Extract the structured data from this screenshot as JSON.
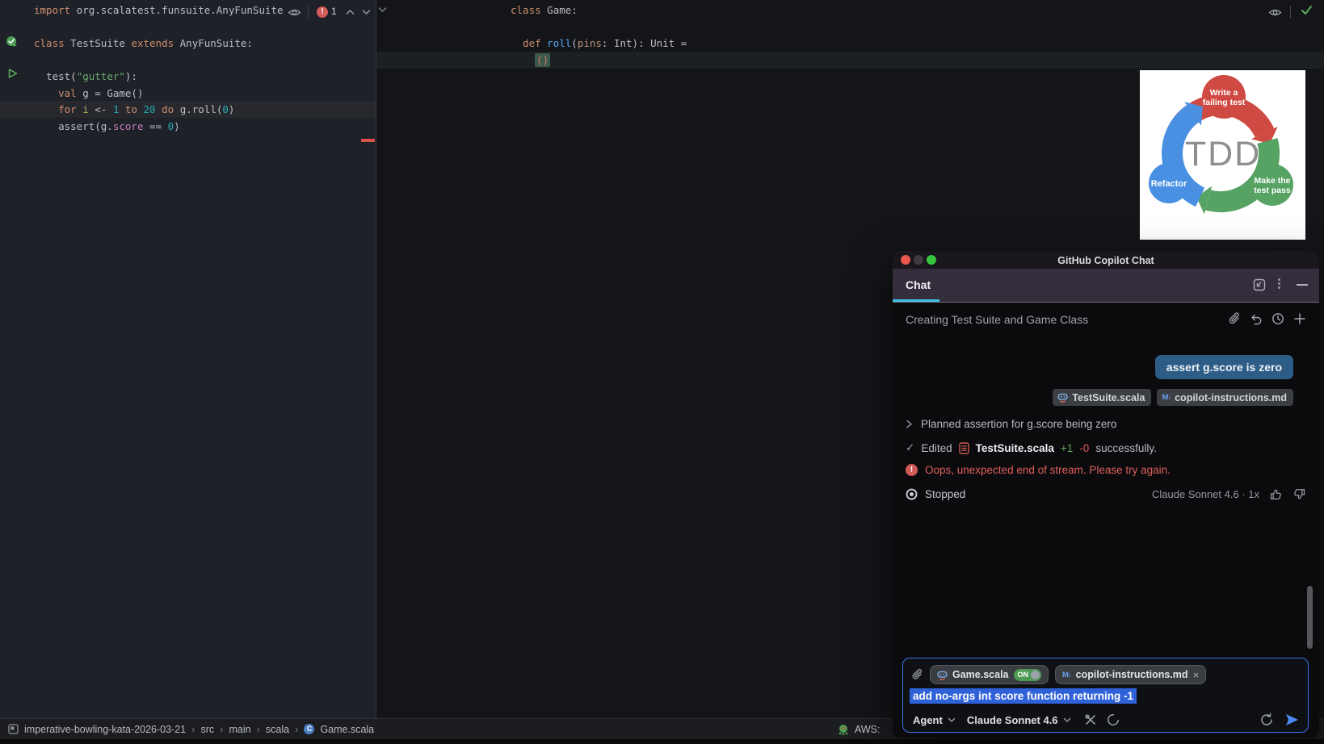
{
  "left_editor": {
    "error_count": "1",
    "lines": [
      {
        "tokens": [
          [
            "import",
            "kw"
          ],
          [
            " org.scalatest.funsuite.AnyFunSuite",
            "pl"
          ]
        ]
      },
      {
        "tokens": []
      },
      {
        "tokens": [
          [
            "class",
            "kw"
          ],
          [
            " TestSuite ",
            "pl"
          ],
          [
            "extends",
            "kw"
          ],
          [
            " AnyFunSuite:",
            "pl"
          ]
        ]
      },
      {
        "tokens": []
      },
      {
        "tokens": [
          [
            "  test(",
            "pl"
          ],
          [
            "\"gutter\"",
            "str"
          ],
          [
            "):",
            "pl"
          ]
        ]
      },
      {
        "tokens": [
          [
            "    ",
            "pl"
          ],
          [
            "val",
            "kw"
          ],
          [
            " g = Game()",
            "pl"
          ]
        ]
      },
      {
        "tokens": [
          [
            "    ",
            "pl"
          ],
          [
            "for",
            "kw"
          ],
          [
            " ",
            "pl"
          ],
          [
            "i",
            "var"
          ],
          [
            " <- ",
            "pl"
          ],
          [
            "1",
            "num"
          ],
          [
            " ",
            "pl"
          ],
          [
            "to",
            "kw"
          ],
          [
            " ",
            "pl"
          ],
          [
            "20",
            "num"
          ],
          [
            " ",
            "pl"
          ],
          [
            "do",
            "kw"
          ],
          [
            " g.roll(",
            "pl"
          ],
          [
            "0",
            "num"
          ],
          [
            ")",
            "pl"
          ]
        ],
        "current": true
      },
      {
        "tokens": [
          [
            "    assert(g.",
            "pl"
          ],
          [
            "score",
            "member"
          ],
          [
            " == ",
            "pl"
          ],
          [
            "0",
            "num"
          ],
          [
            ")",
            "pl"
          ]
        ]
      }
    ]
  },
  "right_editor": {
    "lines": [
      {
        "tokens": [
          [
            "class",
            "kw"
          ],
          [
            " Game:",
            "pl"
          ]
        ]
      },
      {
        "tokens": []
      },
      {
        "tokens": [
          [
            "  ",
            "pl"
          ],
          [
            "def",
            "kw"
          ],
          [
            " ",
            "pl"
          ],
          [
            "roll",
            "fn"
          ],
          [
            "(",
            "pl"
          ],
          [
            "pins",
            "param"
          ],
          [
            ": Int): Unit =",
            "pl"
          ]
        ]
      },
      {
        "tokens": [
          [
            "    ",
            "pl"
          ],
          [
            "()",
            "sel"
          ]
        ],
        "current": true
      }
    ]
  },
  "tdd": {
    "center": "TDD",
    "red_label": [
      "Write a",
      "failing test"
    ],
    "green_label": [
      "Make the",
      "test pass"
    ],
    "blue_label": "Refactor",
    "colors": {
      "red": "#cf4a42",
      "green": "#57a364",
      "blue": "#4a90e2",
      "center_gray": "#8f8f8f"
    }
  },
  "chat": {
    "window_title": "GitHub Copilot Chat",
    "tab_label": "Chat",
    "thread_title": "Creating Test Suite and Game Class",
    "user_message": "assert g.score is zero",
    "attachments": {
      "0": {
        "label": "TestSuite.scala"
      },
      "1": {
        "label": "copilot-instructions.md"
      }
    },
    "planned_step": "Planned assertion for g.score being zero",
    "edited": {
      "verb": "Edited",
      "check": "✓",
      "file": "TestSuite.scala",
      "added": "+1",
      "removed": "-0",
      "suffix": "successfully."
    },
    "error_message": "Oops, unexpected end of stream. Please try again.",
    "error_glyph": "!",
    "stopped_label": "Stopped",
    "model_info": "Claude Sonnet 4.6 · 1x",
    "input": {
      "file_chip": "Game.scala",
      "file_chip_toggle": "ON",
      "instructions_chip": "copilot-instructions.md",
      "chip_close": "×",
      "text_selected": "add no-args int score function returning -1",
      "mode_label": "Agent",
      "model_label": "Claude Sonnet 4.6"
    },
    "md_glyph": "M↓"
  },
  "status_bar": {
    "breadcrumbs": [
      "imperative-bowling-kata-2026-03-21",
      "src",
      "main",
      "scala",
      "Game.scala"
    ],
    "separator": "›",
    "class_glyph": "C",
    "right_text": "AWS:"
  }
}
